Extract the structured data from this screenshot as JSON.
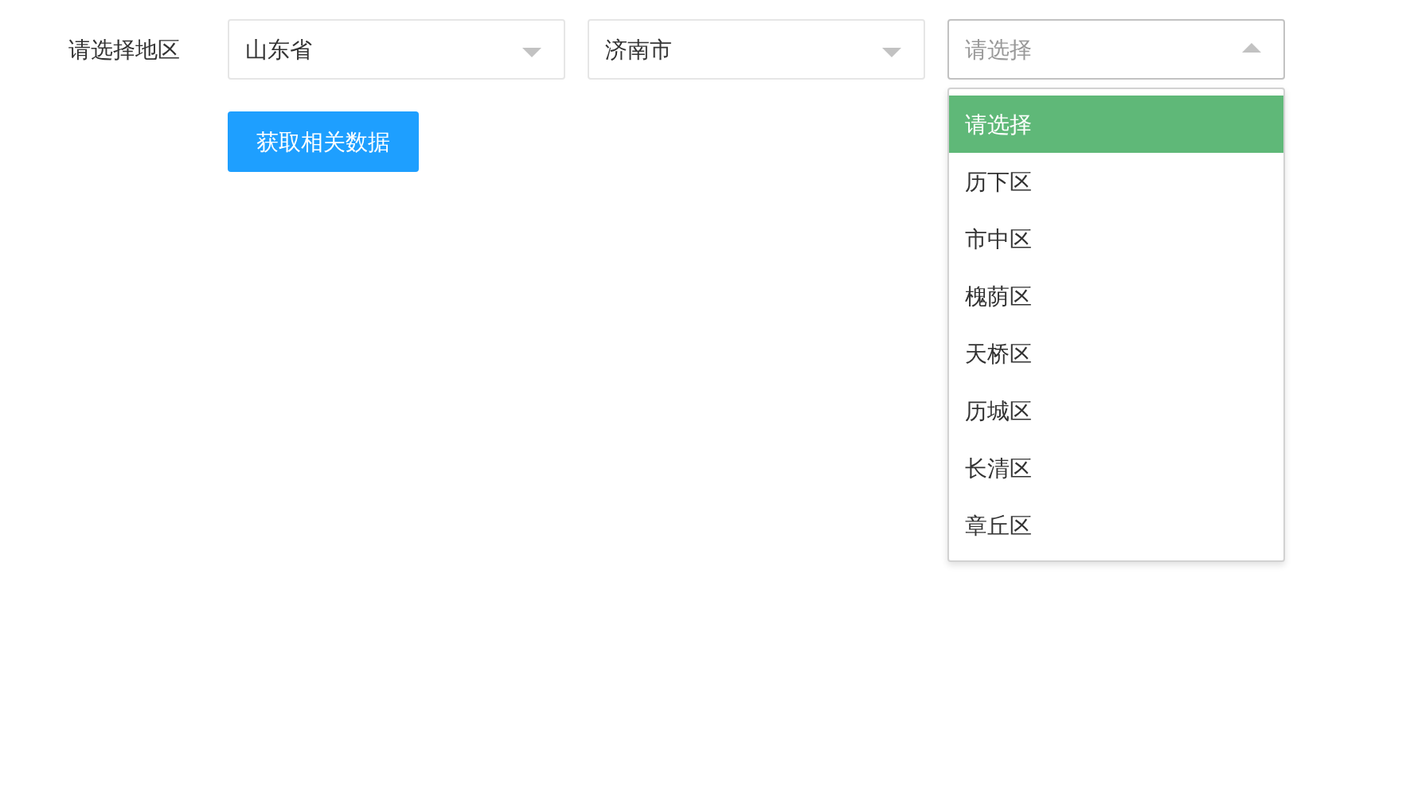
{
  "region_label": "请选择地区",
  "selects": [
    {
      "value": "山东省",
      "open": false
    },
    {
      "value": "济南市",
      "open": false
    },
    {
      "placeholder": "请选择",
      "open": true
    }
  ],
  "dropdown_options": [
    {
      "label": "请选择",
      "selected": true
    },
    {
      "label": "历下区",
      "selected": false
    },
    {
      "label": "市中区",
      "selected": false
    },
    {
      "label": "槐荫区",
      "selected": false
    },
    {
      "label": "天桥区",
      "selected": false
    },
    {
      "label": "历城区",
      "selected": false
    },
    {
      "label": "长清区",
      "selected": false
    },
    {
      "label": "章丘区",
      "selected": false
    }
  ],
  "button": "获取相关数据"
}
